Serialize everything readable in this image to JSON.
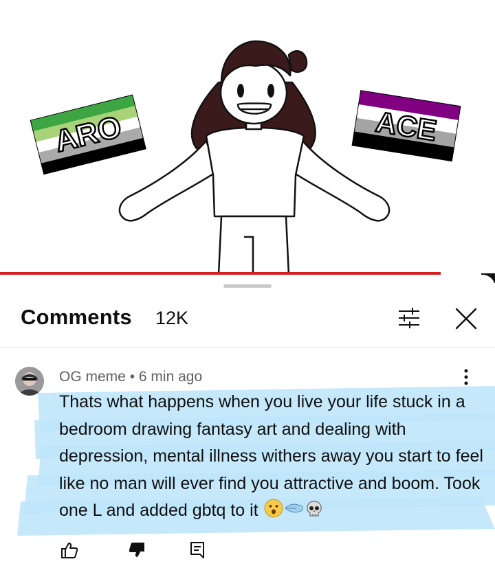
{
  "video": {
    "flags": [
      {
        "label": "ARO",
        "colors": [
          "#3da542",
          "#a8d379",
          "#ffffff",
          "#aaaaaa",
          "#000000"
        ]
      },
      {
        "label": "ACE",
        "colors": [
          "#000000",
          "#a4a4a4",
          "#ffffff",
          "#810081"
        ]
      }
    ],
    "progress_color": "#d42020",
    "progress_fraction": 0.89
  },
  "comments": {
    "title": "Comments",
    "count": "12K",
    "items": [
      {
        "author": "OG meme",
        "separator": "•",
        "time": "6 min ago",
        "text": "Thats what happens when you live your life stuck in a bedroom drawing fantasy art and dealing with depression, mental illness withers away you start to feel like no man will ever find you attractive and boom. Took one L and added gbtq to it",
        "emojis": [
          "hushed-face-icon",
          "dash-icon",
          "skull-icon"
        ],
        "highlight_color": "#bfe6fb"
      }
    ]
  },
  "icons": {
    "filter": "filter-sliders-icon",
    "close": "close-icon",
    "more": "more-vert-icon",
    "like": "thumb-up-icon",
    "dislike": "thumb-down-icon",
    "reply": "reply-comment-icon"
  }
}
